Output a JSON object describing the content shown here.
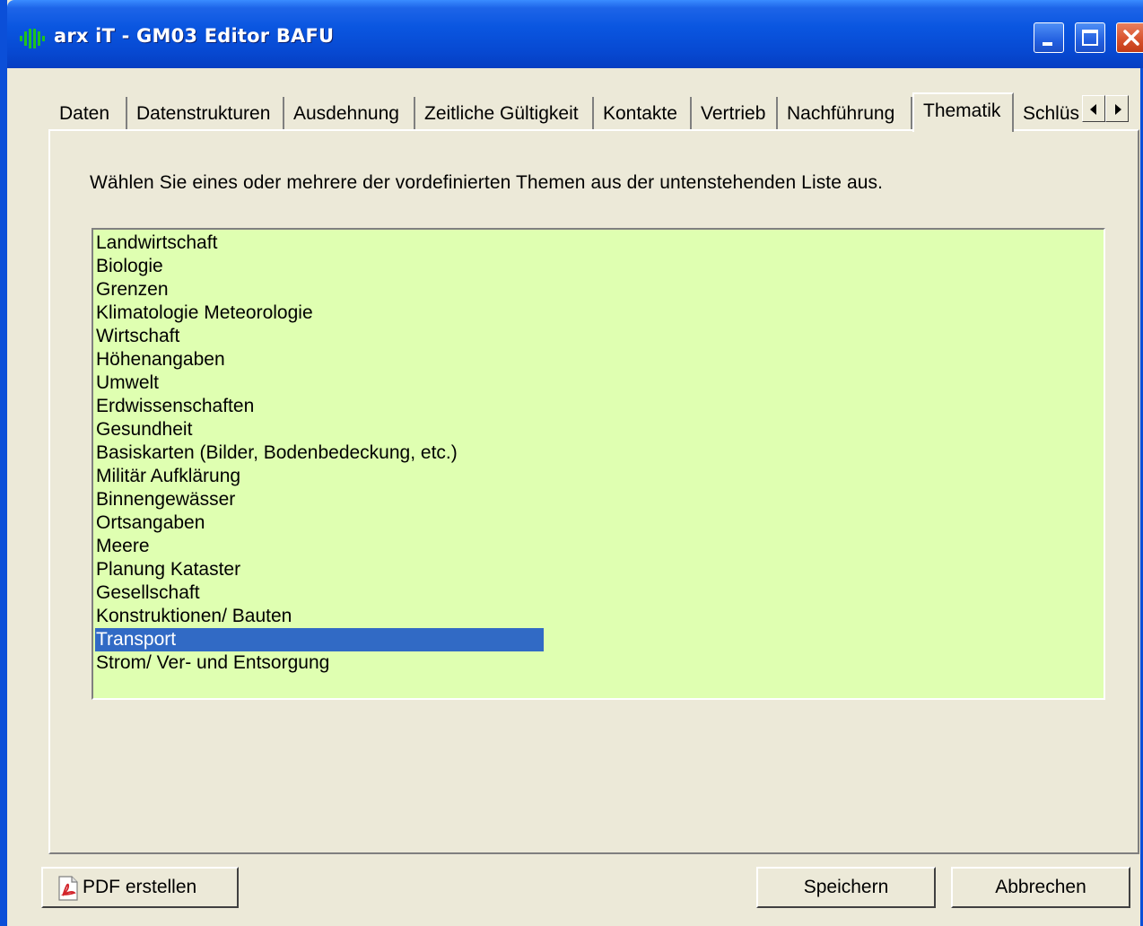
{
  "window": {
    "title": "arx iT - GM03 Editor BAFU"
  },
  "tabs": [
    {
      "label": "Daten",
      "active": false
    },
    {
      "label": "Datenstrukturen",
      "active": false
    },
    {
      "label": "Ausdehnung",
      "active": false
    },
    {
      "label": "Zeitliche Gültigkeit",
      "active": false
    },
    {
      "label": "Kontakte",
      "active": false
    },
    {
      "label": "Vertrieb",
      "active": false
    },
    {
      "label": "Nachführung",
      "active": false
    },
    {
      "label": "Thematik",
      "active": true
    },
    {
      "label": "Schlüs",
      "active": false
    }
  ],
  "tab_scroll": {
    "left_icon": "arrow-left-icon",
    "right_icon": "arrow-right-icon"
  },
  "thematik": {
    "instruction": "Wählen Sie eines oder mehrere der vordefinierten Themen aus der untenstehenden Liste aus.",
    "list_background": "#dfffb1",
    "selection_color": "#316ac5",
    "items": [
      "Landwirtschaft",
      "Biologie",
      "Grenzen",
      "Klimatologie Meteorologie",
      "Wirtschaft",
      "Höhenangaben",
      "Umwelt",
      "Erdwissenschaften",
      "Gesundheit",
      "Basiskarten (Bilder, Bodenbedeckung, etc.)",
      "Militär Aufklärung",
      "Binnengewässer",
      "Ortsangaben",
      "Meere",
      "Planung Kataster",
      "Gesellschaft",
      "Konstruktionen/ Bauten",
      "Transport",
      "Strom/ Ver- und Entsorgung"
    ],
    "selected_item": "Transport"
  },
  "buttons": {
    "pdf": "PDF erstellen",
    "pdf_icon": "pdf-icon",
    "save": "Speichern",
    "cancel": "Abbrechen"
  }
}
